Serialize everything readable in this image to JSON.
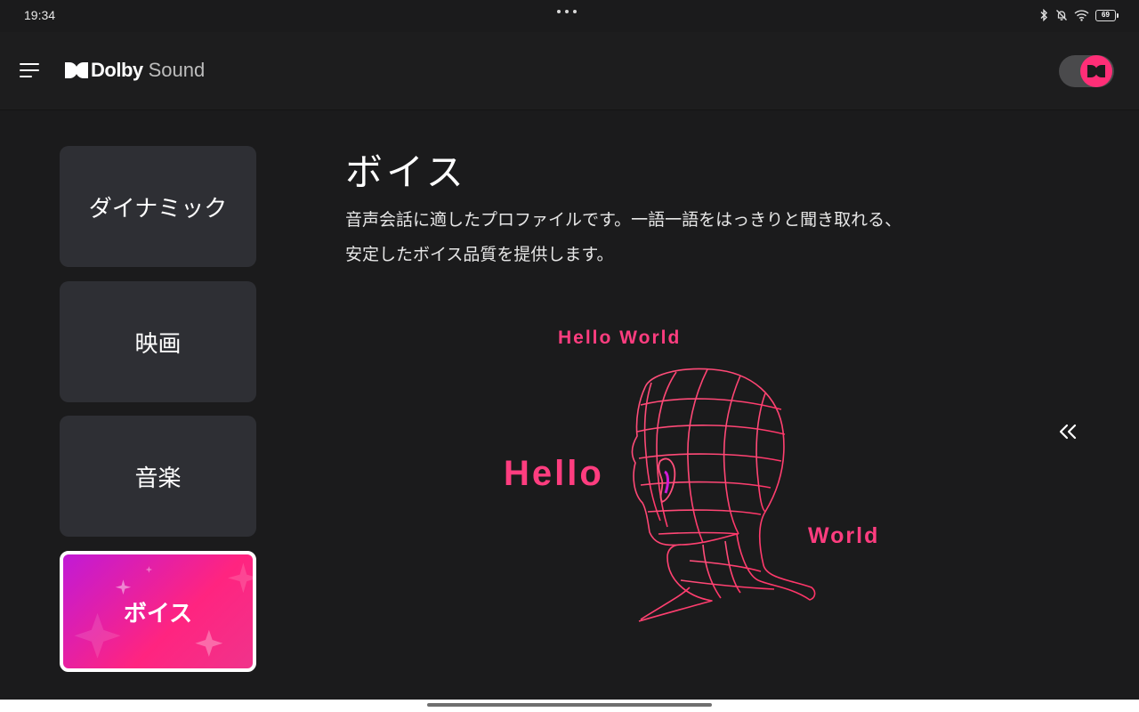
{
  "status_bar": {
    "time": "19:34",
    "battery_level": "69",
    "icons": [
      "bluetooth-icon",
      "bell-off-icon",
      "wifi-icon",
      "battery-icon"
    ]
  },
  "header": {
    "logo_word": "Dolby",
    "logo_sound": "Sound",
    "menu_icon": "hamburger-menu-icon",
    "toggle_on": true,
    "accent_color": "#ff2e77"
  },
  "profiles": {
    "items": [
      {
        "label": "ダイナミック",
        "active": false
      },
      {
        "label": "映画",
        "active": false
      },
      {
        "label": "音楽",
        "active": false
      },
      {
        "label": "ボイス",
        "active": true
      }
    ]
  },
  "main": {
    "title": "ボイス",
    "description_line1": "音声会話に適したプロファイルです。一語一語をはっきりと聞き取れる、",
    "description_line2": "安定したボイス品質を提供します。",
    "illustration": {
      "text_top": "Hello World",
      "text_left": "Hello",
      "text_right": "World",
      "line_color": "#ff4f7b"
    },
    "collapse_icon": "double-chevron-left-icon"
  }
}
